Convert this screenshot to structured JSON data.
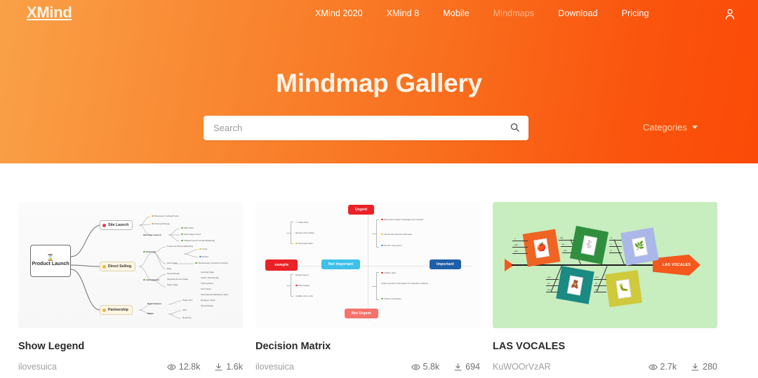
{
  "header": {
    "logo": "XMind",
    "nav": [
      {
        "label": "XMind 2020",
        "active": false
      },
      {
        "label": "XMind 8",
        "active": false
      },
      {
        "label": "Mobile",
        "active": false
      },
      {
        "label": "Mindmaps",
        "active": true
      },
      {
        "label": "Download",
        "active": false
      },
      {
        "label": "Pricing",
        "active": false
      }
    ],
    "account_icon": "user-icon",
    "title": "Mindmap Gallery",
    "search": {
      "value": "",
      "placeholder": "Search",
      "icon": "search-icon"
    },
    "categories": {
      "label": "Categories",
      "icon": "chevron-down-icon"
    },
    "colors": {
      "gradient_from": "#f9a147",
      "gradient_to": "#fb4a07",
      "title_color": "#fdf3e6"
    }
  },
  "gallery": {
    "cards": [
      {
        "title": "Show Legend",
        "author": "ilovesuica",
        "views": "12.8k",
        "downloads": "1.6k",
        "views_icon": "eye-icon",
        "downloads_icon": "download-icon",
        "thumbnail": {
          "type": "mindmap",
          "root": "Product Launch",
          "root_icon": "hourglass-icon",
          "branches": [
            {
              "label": "Site Launch",
              "marker_color": "#ec3a4b",
              "children": [
                "Brainstorm Selling Points",
                "Pricing Strategy",
                "Site Page Launch",
                "SEO Plan",
                "Web Page Check",
                "Official Launch"
              ]
            },
            {
              "label": "Direct Selling",
              "marker_color": "#f2b63c",
              "children": [
                "Domestic",
                "International",
                "Customer Direct Marketing",
                "Copy",
                "Poster",
                "Ads Guide",
                "Woodsmoke Constant Clothing",
                "Blog",
                "Social Media",
                "Targeted Promo Page",
                "Sales Page",
                "Email Marketing",
                "Landing Page",
                "Online Scholarship",
                "Pricing Rules",
                "Tech Team",
                "International Marketing Team",
                "Designer Team",
                "Social Media"
              ]
            },
            {
              "label": "Partnership",
              "marker_color": "#f2b63c",
              "children": [
                "Paid Channel",
                "Media",
                "Paid of it's",
                "ADT",
                "Brochure"
              ]
            }
          ]
        }
      },
      {
        "title": "Decision Matrix",
        "author": "ilovesuica",
        "views": "5.8k",
        "downloads": "694",
        "views_icon": "eye-icon",
        "downloads_icon": "download-icon",
        "thumbnail": {
          "type": "matrix",
          "axis_tags": [
            {
              "label": "Urgent",
              "color": "#ea2127",
              "position": "top"
            },
            {
              "label": "Not Urgent",
              "color": "#f4746c",
              "position": "bottom"
            },
            {
              "label": "Important",
              "color": "#1f5fa8",
              "position": "right"
            },
            {
              "label": "Not Important",
              "color": "#3ec0e8",
              "position": "left"
            }
          ],
          "sample_tag": {
            "label": "sample",
            "color": "#ea2127"
          },
          "quadrants": [
            {
              "name": "urgent-not-important",
              "items": [
                "Data track",
                "Review and critique",
                "Send gift cards"
              ]
            },
            {
              "name": "urgent-important",
              "items": [
                "Brainstorm ideas & background research",
                "Check and discuss with team",
                "Set the copy items"
              ]
            },
            {
              "name": "not-urgent-not-important",
              "items": [
                "Design layout",
                "Edit images",
                "Update color code"
              ]
            },
            {
              "name": "not-urgent-important",
              "items": [
                "Outline sites",
                "Collect product information & competitor analysis",
                "Theme interaction"
              ]
            }
          ]
        }
      },
      {
        "title": "LAS VOCALES",
        "author": "KuWOOrVzAR",
        "views": "2.7k",
        "downloads": "280",
        "views_icon": "eye-icon",
        "downloads_icon": "download-icon",
        "thumbnail": {
          "type": "fishbone",
          "background": "#c8edbf",
          "head_label": "LAS VOCALES",
          "head_color": "#f4581d",
          "bones": [
            {
              "color": "#f06423",
              "glyph": "🍎",
              "labels": [
                "a",
                "aaa",
                "aaa"
              ]
            },
            {
              "color": "#2f8f3f",
              "glyph": "🐇",
              "labels": [
                "eee",
                "ee",
                "eee"
              ]
            },
            {
              "color": "#aab7e8",
              "glyph": "🌿",
              "labels": [
                "iii",
                "ii",
                "iii"
              ]
            },
            {
              "color": "#1a8a82",
              "glyph": "🧸",
              "labels": [
                "ooo",
                "oo",
                "ooo"
              ]
            },
            {
              "color": "#cfc93c",
              "glyph": "🐛",
              "labels": [
                "uuu",
                "uu",
                "uuu"
              ]
            }
          ]
        }
      }
    ]
  }
}
